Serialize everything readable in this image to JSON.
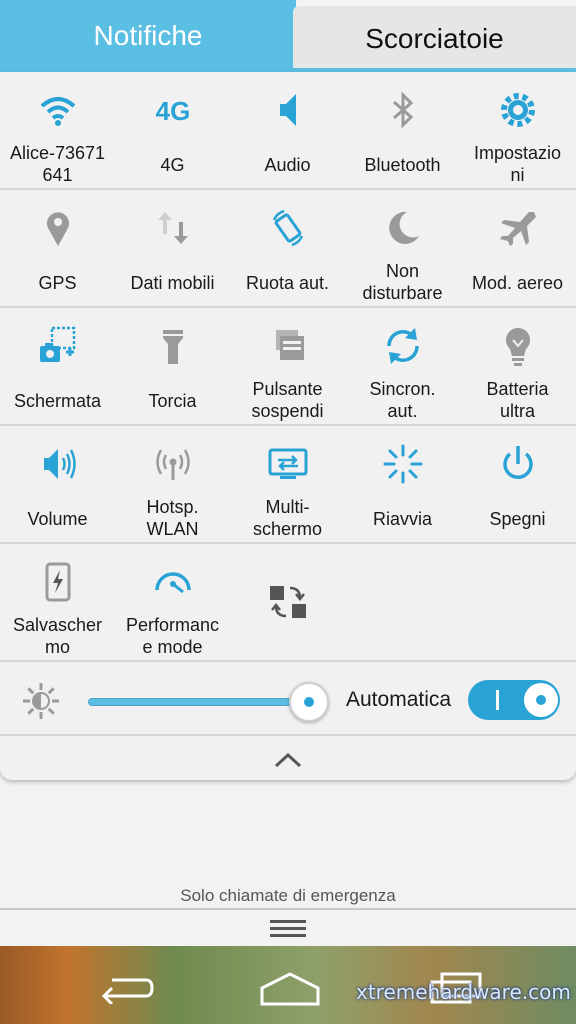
{
  "tabs": {
    "notifications": "Notifiche",
    "shortcuts": "Scorciatoie"
  },
  "tiles": [
    [
      {
        "label": "Alice-73671\n641",
        "icon": "wifi-icon",
        "color": "#29a3d6"
      },
      {
        "label": "4G",
        "icon": "4g-icon",
        "icon_text": "4G",
        "color": "#29a3d6"
      },
      {
        "label": "Audio",
        "icon": "speaker-icon",
        "color": "#29a3d6"
      },
      {
        "label": "Bluetooth",
        "icon": "bluetooth-icon",
        "color": "#9a9a9a"
      },
      {
        "label": "Impostazio\nni",
        "icon": "gear-icon",
        "color": "#29a3d6"
      }
    ],
    [
      {
        "label": "GPS",
        "icon": "location-pin-icon",
        "color": "#9a9a9a"
      },
      {
        "label": "Dati mobili",
        "icon": "data-arrows-icon",
        "color": "#9a9a9a"
      },
      {
        "label": "Ruota aut.",
        "icon": "rotate-icon",
        "color": "#29a3d6"
      },
      {
        "label": "Non\ndisturbare",
        "icon": "moon-icon",
        "color": "#9a9a9a"
      },
      {
        "label": "Mod. aereo",
        "icon": "airplane-icon",
        "color": "#9a9a9a"
      }
    ],
    [
      {
        "label": "Schermata",
        "icon": "screenshot-icon",
        "color": "#29a3d6"
      },
      {
        "label": "Torcia",
        "icon": "flashlight-icon",
        "color": "#9a9a9a"
      },
      {
        "label": "Pulsante\nsospendi",
        "icon": "floating-button-icon",
        "color": "#9a9a9a"
      },
      {
        "label": "Sincron.\naut.",
        "icon": "sync-icon",
        "color": "#29a3d6"
      },
      {
        "label": "Batteria\nultra",
        "icon": "bulb-icon",
        "color": "#9a9a9a"
      }
    ],
    [
      {
        "label": "Volume",
        "icon": "volume-icon",
        "color": "#29a3d6"
      },
      {
        "label": "Hotsp.\nWLAN",
        "icon": "hotspot-icon",
        "color": "#9a9a9a"
      },
      {
        "label": "Multi-\nschermo",
        "icon": "multiscreen-icon",
        "color": "#29a3d6"
      },
      {
        "label": "Riavvia",
        "icon": "restart-icon",
        "color": "#29a3d6"
      },
      {
        "label": "Spegni",
        "icon": "power-icon",
        "color": "#29a3d6"
      }
    ],
    [
      {
        "label": "Salvascher\nmo",
        "icon": "phone-charge-icon",
        "color": "#9a9a9a"
      },
      {
        "label": "Performanc\ne mode",
        "icon": "gauge-icon",
        "color": "#29a3d6"
      },
      {
        "label": "",
        "icon": "edit-swap-icon",
        "color": "#555555"
      }
    ]
  ],
  "brightness": {
    "level_percent": 96,
    "auto_label": "Automatica",
    "auto_enabled": true
  },
  "status": {
    "emergency": "Solo chiamate di emergenza"
  },
  "watermark": "xtremehardware.com",
  "colors": {
    "accent": "#29a3d6",
    "tab_active": "#5bbfe3",
    "inactive_icon": "#9a9a9a"
  }
}
